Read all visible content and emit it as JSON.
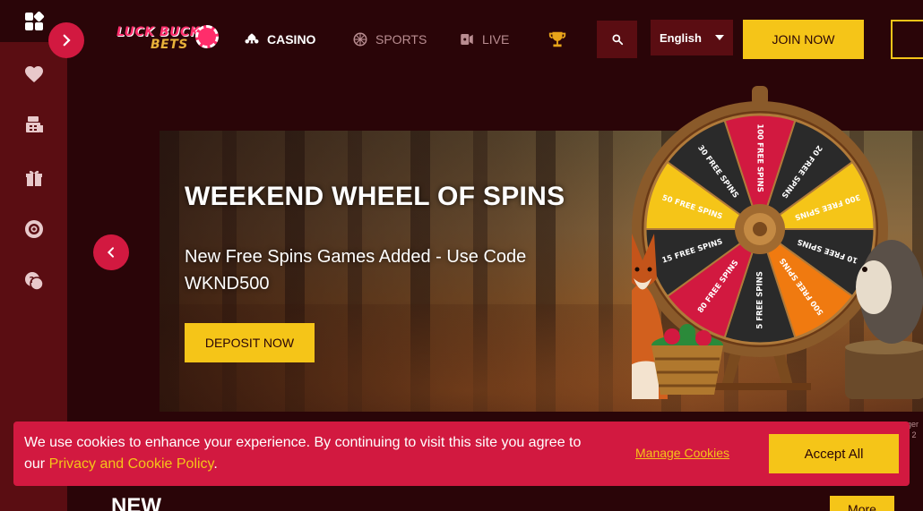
{
  "sidebar": {
    "items": [
      {
        "icon": "grid-icon"
      },
      {
        "icon": "heart-icon"
      },
      {
        "icon": "cashier-icon"
      },
      {
        "icon": "gift-icon"
      },
      {
        "icon": "lifebuoy-icon"
      },
      {
        "icon": "help-chat-icon"
      }
    ]
  },
  "header": {
    "logo_line1": "LUCK BUCK",
    "logo_line2": "BETS",
    "nav": [
      {
        "label": "CASINO",
        "icon": "cards-icon"
      },
      {
        "label": "SPORTS",
        "icon": "ball-icon"
      },
      {
        "label": "LIVE",
        "icon": "live-dealer-icon"
      }
    ],
    "language": "English",
    "join_label": "JOIN NOW"
  },
  "banner": {
    "title": "WEEKEND WHEEL OF SPINS",
    "subtitle": "New Free Spins Games Added - Use Code WKND500",
    "deposit_label": "DEPOSIT NOW",
    "wheel_segments": [
      "100 FREE SPINS",
      "20 FREE SPINS",
      "300 FREE SPINS",
      "10 FREE SPINS",
      "500 FREE SPINS",
      "5 FREE SPINS",
      "80 FREE SPINS",
      "15 FREE SPINS",
      "50 FREE SPINS",
      "30 FREE SPINS"
    ]
  },
  "cookie": {
    "text_before": "We use cookies to enhance your experience. By continuing to visit this site you agree to our ",
    "policy_link": "Privacy and Cookie Policy",
    "text_after": ".",
    "manage_label": "Manage Cookies",
    "accept_label": "Accept All"
  },
  "side_note": "ger\nr 2",
  "section": {
    "title": "NEW",
    "more_label": "More"
  },
  "colors": {
    "accent": "#d21940",
    "cta": "#f5c518",
    "background": "#2a0508",
    "sidebar": "#5a0d12"
  }
}
